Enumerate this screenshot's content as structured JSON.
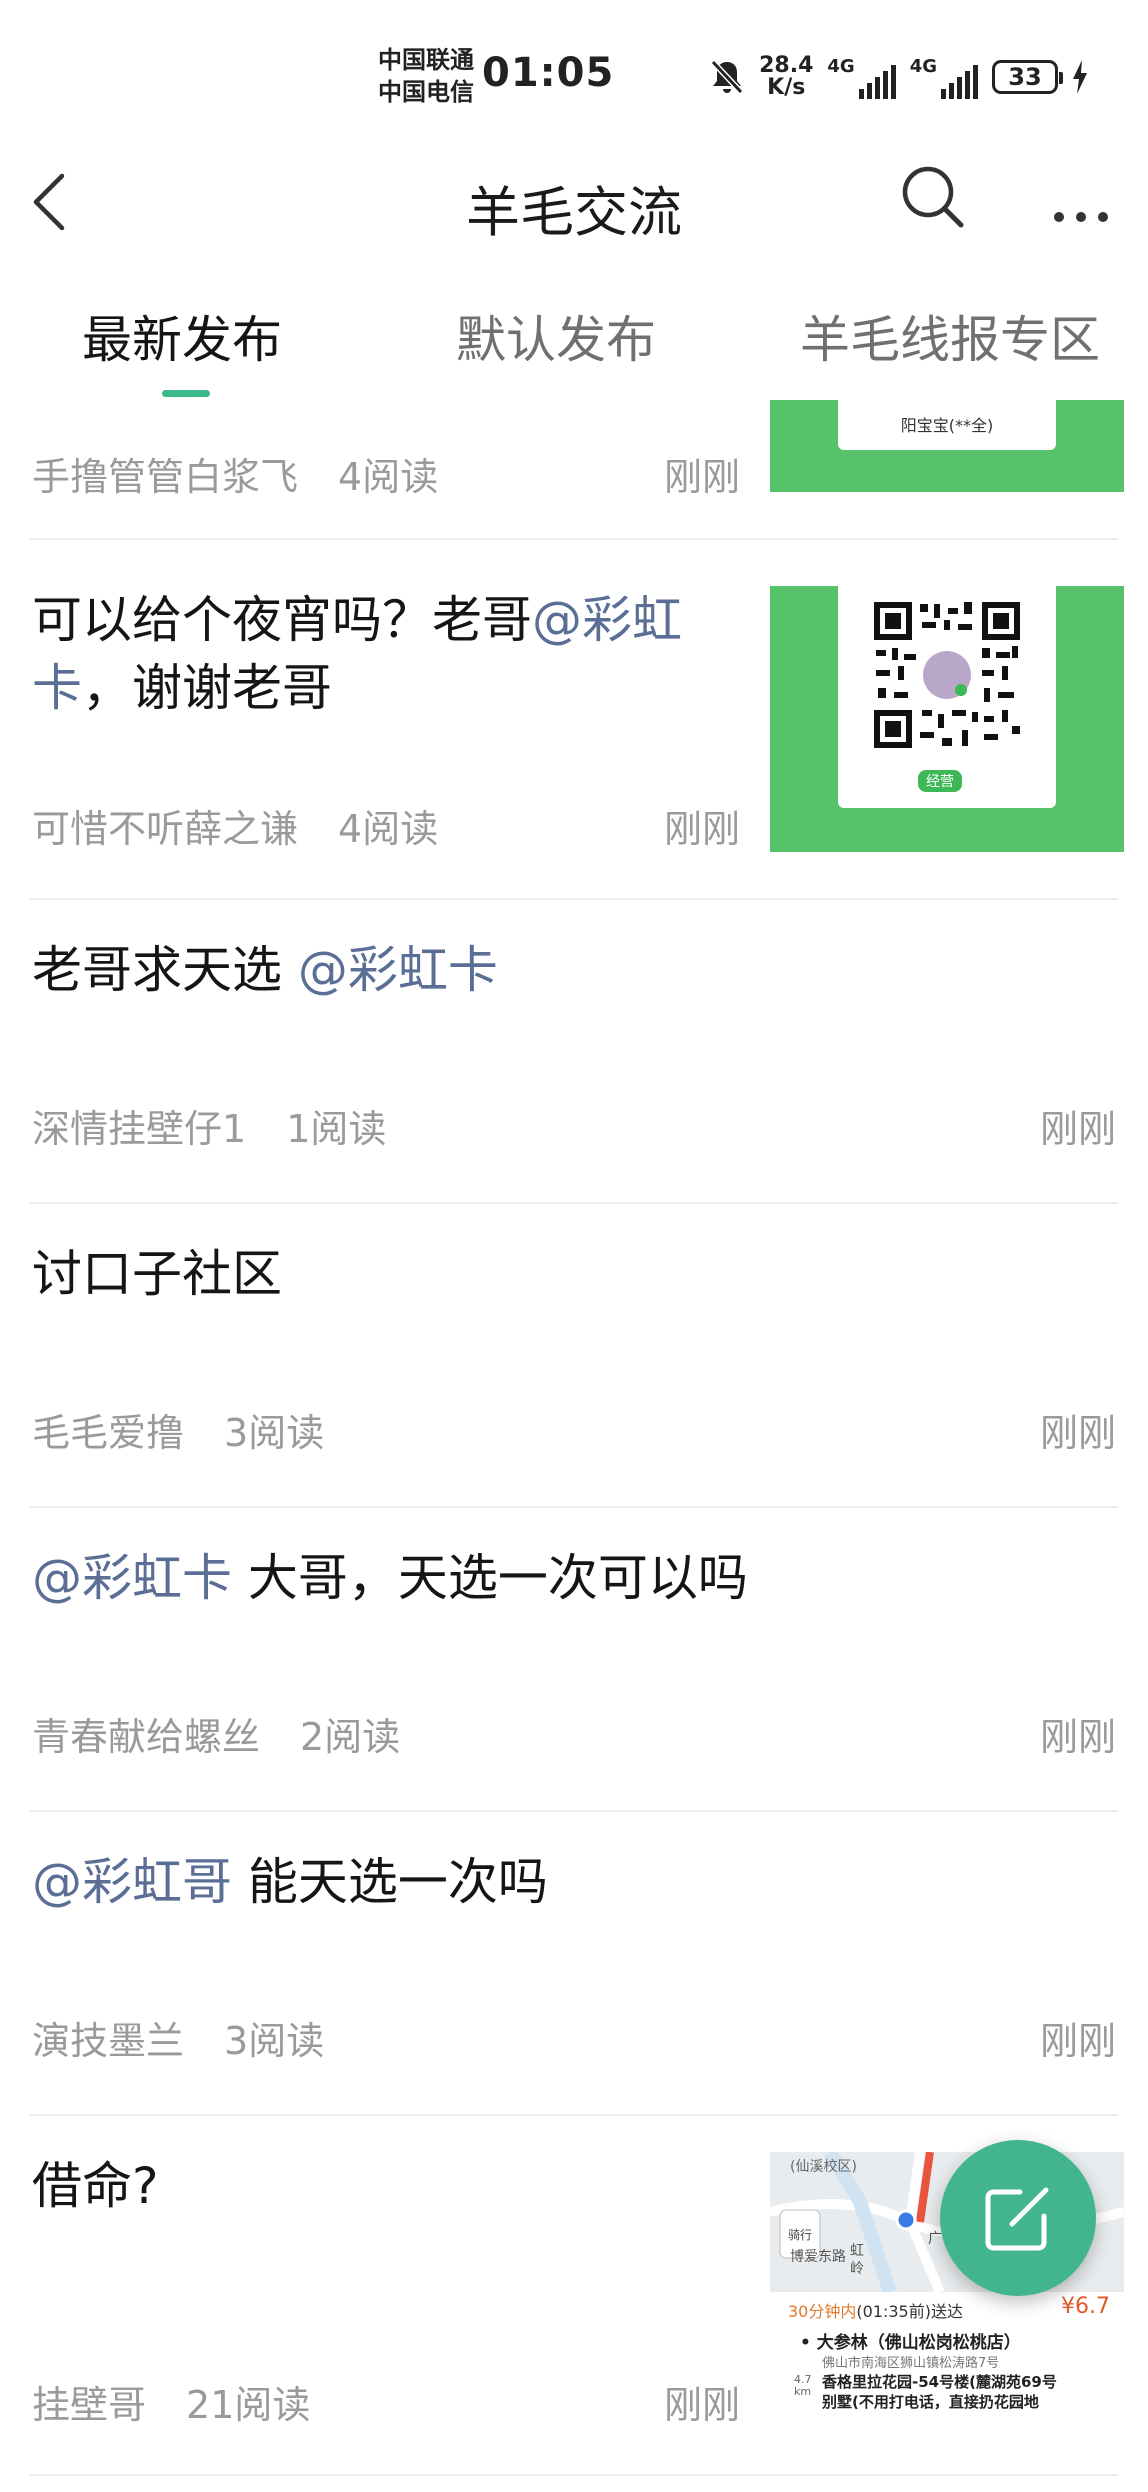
{
  "status_bar": {
    "carrier_1": "中国联通",
    "carrier_2": "中国电信",
    "time": "01:05",
    "net_speed_value": "28.4",
    "net_speed_unit": "K/s",
    "network_1": "4G",
    "network_2": "4G",
    "battery": "33"
  },
  "nav": {
    "title": "羊毛交流"
  },
  "tabs": [
    {
      "label": "最新发布",
      "active": true
    },
    {
      "label": "默认发布",
      "active": false
    },
    {
      "label": "羊毛线报专区",
      "active": false
    }
  ],
  "posts": [
    {
      "author": "手撸管管白浆飞",
      "reads": "4阅读",
      "time": "刚刚",
      "thumb_caption": "阳宝宝(**全)"
    },
    {
      "title_text": "可以给个夜宵吗？老哥",
      "mention": "@彩虹卡",
      "title_tail": "，谢谢老哥",
      "author": "可惜不听薛之谦",
      "reads": "4阅读",
      "time": "刚刚",
      "thumb_badge": "经营"
    },
    {
      "title_text": "老哥求天选 ",
      "mention": "@彩虹卡",
      "author": "深情挂壁仔1",
      "reads": "1阅读",
      "time": "刚刚"
    },
    {
      "title_text": "讨口子社区",
      "author": "毛毛爱撸",
      "reads": "3阅读",
      "time": "刚刚"
    },
    {
      "mention": "@彩虹卡",
      "title_tail": " 大哥，天选一次可以吗",
      "author": "青春献给螺丝",
      "reads": "2阅读",
      "time": "刚刚"
    },
    {
      "mention": "@彩虹哥",
      "title_tail": " 能天选一次吗",
      "author": "演技墨兰",
      "reads": "3阅读",
      "time": "刚刚"
    },
    {
      "title_text": "借命?",
      "author": "挂壁哥",
      "reads": "21阅读",
      "time": "刚刚",
      "map": {
        "campus": "(仙溪校区)",
        "road": "博爱东路",
        "place_a": "虹",
        "place_b": "岭",
        "place_c": "广",
        "ride_label": "骑行",
        "delivery": "30分钟内",
        "delivery_time": "(01:35前)送达",
        "price": "¥6.7",
        "shop": "大参林（佛山松岗松桃店）",
        "shop_addr": "佛山市南海区狮山镇松涛路7号",
        "distance": "4.7",
        "distance_unit": "km",
        "dest": "香格里拉花园-54号楼(麓湖苑69号",
        "dest_2": "别墅(不用打电话，直接扔花园地"
      }
    }
  ],
  "colors": {
    "accent": "#3cb888",
    "mention": "#5b6f96",
    "meta": "#9a9a9a",
    "thumb_green": "#56c26a"
  }
}
